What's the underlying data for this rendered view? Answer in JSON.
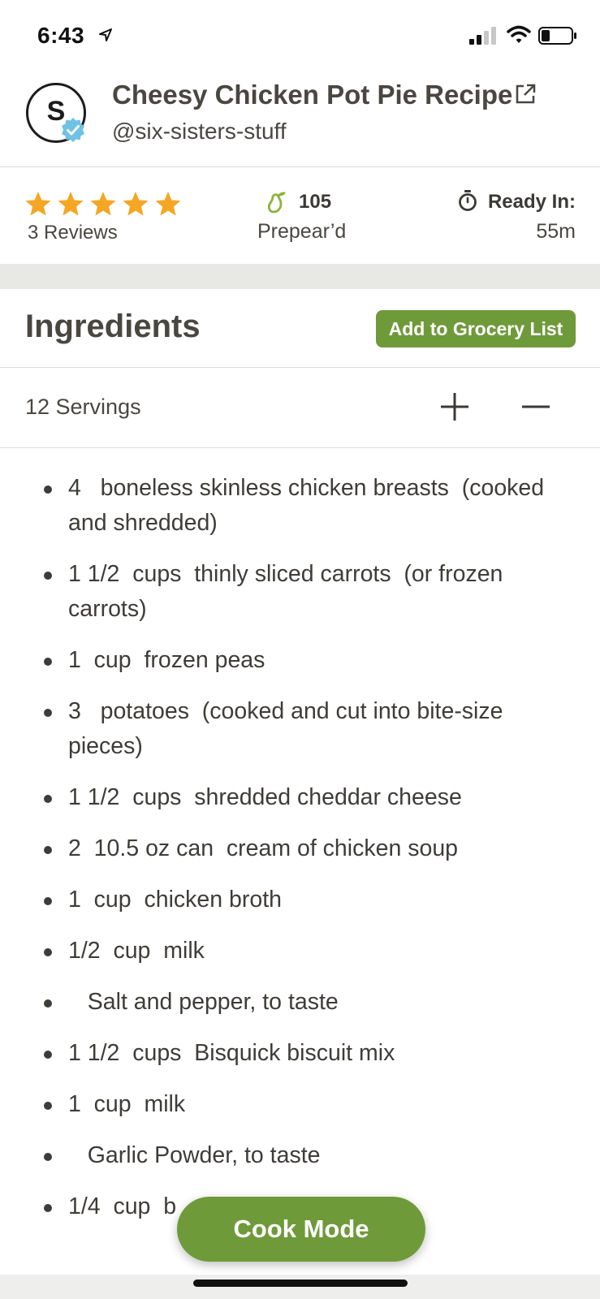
{
  "status_bar": {
    "time": "6:43"
  },
  "header": {
    "avatar_letter": "S",
    "title": "Cheesy Chicken Pot Pie Recipe",
    "author": "@six-sisters-stuff"
  },
  "stats": {
    "rating": 5,
    "reviews": "3 Reviews",
    "prepeared_count": "105",
    "prepeared_label": "Prepear’d",
    "ready_label": "Ready In:",
    "ready_value": "55m"
  },
  "ingredients": {
    "title": "Ingredients",
    "grocery_button": "Add to Grocery List",
    "servings": "12 Servings",
    "items": [
      "4   boneless skinless chicken breasts  (cooked and shredded)",
      "1 1/2  cups  thinly sliced carrots  (or frozen carrots)",
      "1  cup  frozen peas",
      "3   potatoes  (cooked and cut into bite-size pieces)",
      "1 1/2  cups  shredded cheddar cheese",
      "2  10.5 oz can  cream of chicken soup",
      "1  cup  chicken broth",
      "1/2  cup  milk",
      "   Salt and pepper, to taste",
      "1 1/2  cups  Bisquick biscuit mix",
      "1  cup  milk",
      "   Garlic Powder, to taste",
      "1/4  cup  b"
    ]
  },
  "cook_mode_button": "Cook Mode",
  "colors": {
    "accent_green": "#6f9a3a",
    "star_orange": "#f5a623",
    "verified_blue": "#6fc2e3"
  }
}
